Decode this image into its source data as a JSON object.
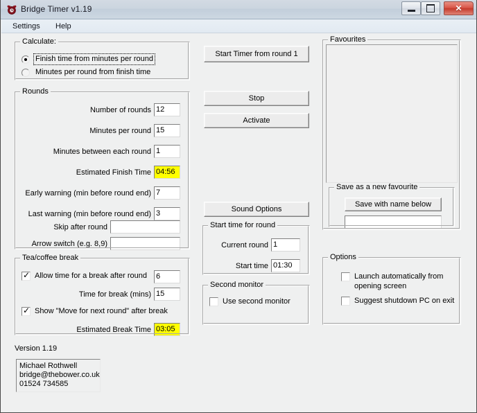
{
  "window": {
    "title": "Bridge Timer v1.19",
    "icon": "alarm-clock-icon",
    "minimize_label": "",
    "maximize_label": "",
    "close_label": "✕"
  },
  "menu": {
    "items": [
      {
        "label": "Settings"
      },
      {
        "label": "Help"
      }
    ]
  },
  "calculate": {
    "title": "Calculate:",
    "options": [
      {
        "label": "Finish time from minutes per round",
        "selected": true
      },
      {
        "label": "Minutes per round from finish time",
        "selected": false
      }
    ]
  },
  "rounds": {
    "title": "Rounds",
    "fields": [
      {
        "label": "Number of rounds",
        "value": "12"
      },
      {
        "label": "Minutes per round",
        "value": "15"
      },
      {
        "label": "Minutes between each round",
        "value": "1"
      },
      {
        "label": "Estimated Finish Time",
        "value": "04:56"
      },
      {
        "label": "Early warning (min before round end)",
        "value": "7"
      },
      {
        "label": "Last warning (min before round end)",
        "value": "3"
      },
      {
        "label": "Skip after round",
        "value": ""
      },
      {
        "label": "Arrow switch (e.g. 8,9)",
        "value": ""
      }
    ]
  },
  "break": {
    "title": "Tea/coffee break",
    "allow_break_label": "Allow time for a break after round",
    "allow_break_checked": true,
    "allow_break_value": "6",
    "time_for_break_label": "Time for break (mins)",
    "time_for_break_value": "15",
    "show_move_label": "Show \"Move for next round\" after break",
    "show_move_checked": true,
    "estimated_break_label": "Estimated Break Time",
    "estimated_break_value": "03:05"
  },
  "version": {
    "label": "Version 1.19",
    "contact_name": "Michael Rothwell",
    "contact_email": "bridge@thebower.co.uk",
    "contact_phone": "01524 734585"
  },
  "actions": {
    "start_timer": "Start Timer from round 1",
    "stop": "Stop",
    "activate": "Activate",
    "sound_options": "Sound Options"
  },
  "start_time": {
    "title": "Start time for round",
    "current_round_label": "Current round",
    "current_round_value": "1",
    "start_time_label": "Start time",
    "start_time_value": "01:30"
  },
  "second_monitor": {
    "title": "Second monitor",
    "use_label": "Use second monitor",
    "use_checked": false
  },
  "favourites": {
    "title": "Favourites",
    "items": []
  },
  "save_favourite": {
    "title": "Save as a new favourite",
    "button_label": "Save with name below",
    "name_value": "",
    "name_placeholder": ""
  },
  "options": {
    "title": "Options",
    "items": [
      {
        "label": "Launch automatically from opening screen",
        "checked": false
      },
      {
        "label": "Suggest shutdown PC on exit",
        "checked": false
      }
    ]
  },
  "colors": {
    "highlight_yellow": "#ffff00",
    "window_face": "#eff0f0",
    "close_red": "#c43a2c"
  }
}
